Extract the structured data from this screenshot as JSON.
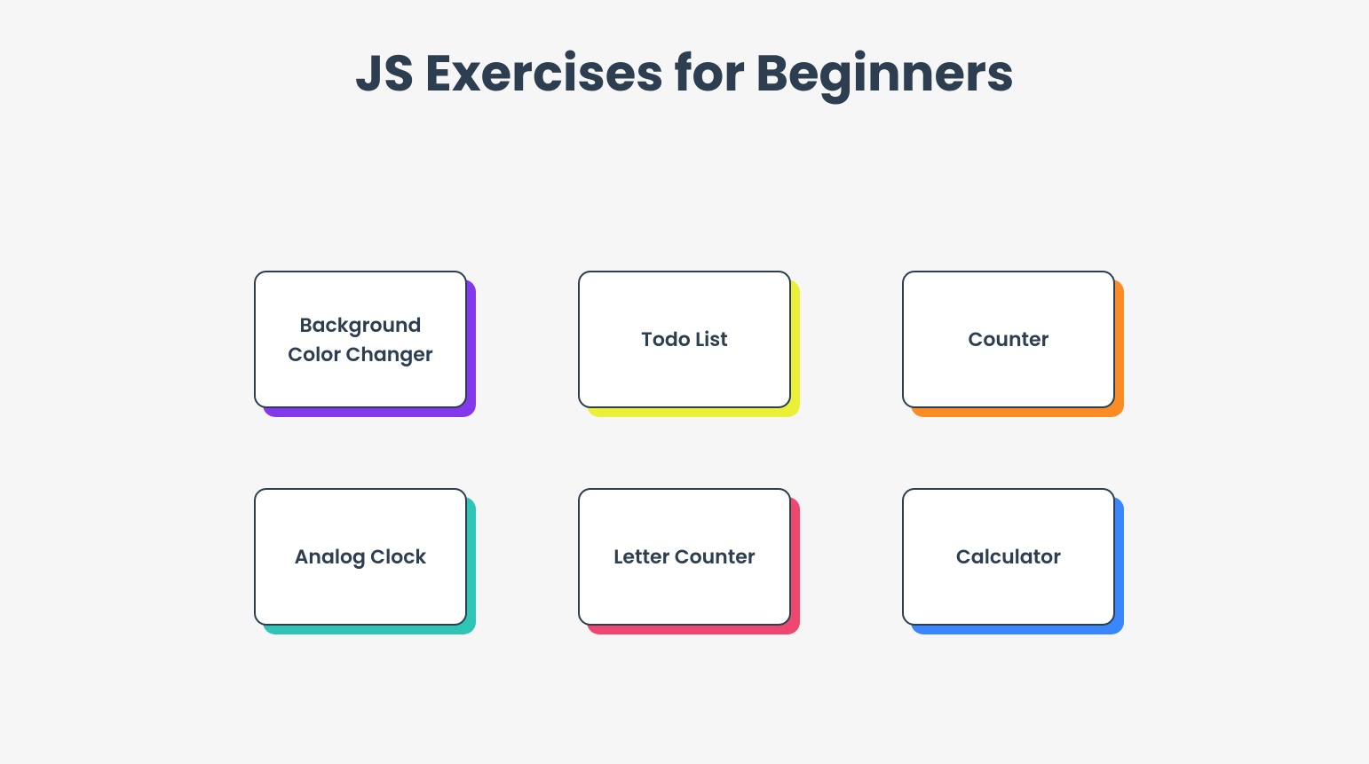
{
  "title": "JS Exercises for Beginners",
  "cards": [
    {
      "label": "Background Color Changer",
      "shadow_color": "#8338ec"
    },
    {
      "label": "Todo List",
      "shadow_color": "#e9f035"
    },
    {
      "label": "Counter",
      "shadow_color": "#fb8b24"
    },
    {
      "label": "Analog Clock",
      "shadow_color": "#2ec4b6"
    },
    {
      "label": "Letter Counter",
      "shadow_color": "#ef476f"
    },
    {
      "label": "Calculator",
      "shadow_color": "#3a86ff"
    }
  ]
}
